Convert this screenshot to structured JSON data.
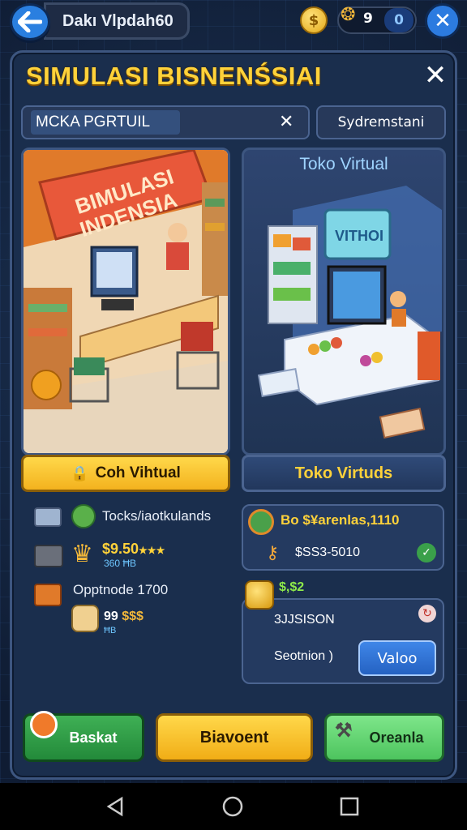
{
  "topbar": {
    "username": "Dakı Vlpdah60",
    "coin_symbol": "$",
    "resource_value": "9",
    "gem_value": "0"
  },
  "panel": {
    "title": "SIMULASI BISNENŚSIAI",
    "search_value": "MCKA PGRTUIL",
    "filter_label": "Sydremstani"
  },
  "cards": {
    "left": {
      "sign_line1": "BIMULASI",
      "sign_line2": "INDENSIA",
      "button_label": "Coh Vihtual"
    },
    "right": {
      "heading": "Toko Virtual",
      "sign": "VITHOI",
      "button_label": "Toko Virtuds"
    }
  },
  "stats_left": {
    "row1_label": "Tocks/iaotkulands",
    "row2_value": "$9.50",
    "row2_sub": "360 ĦB",
    "row3_label": "Opptnode 1700",
    "row4_value": "99",
    "row4_coins": "$$$",
    "row4_sub": "ĦB"
  },
  "stats_right": {
    "box1_line1": "Bo $¥arenlas,1110",
    "box1_line2": "$SS3-5010",
    "box2_badge": "$,$2",
    "box2_line1": "3JJSISON",
    "box2_line2": "Seotnion )",
    "box2_button": "Valoo"
  },
  "bottom_buttons": {
    "left": "Baskat",
    "center": "Biavoent",
    "right": "Oreanla"
  },
  "colors": {
    "title_yellow": "#ffd23a",
    "panel_bg": "#1a2e4d",
    "accent_blue": "#2c7be0",
    "button_green": "#3fb055"
  }
}
